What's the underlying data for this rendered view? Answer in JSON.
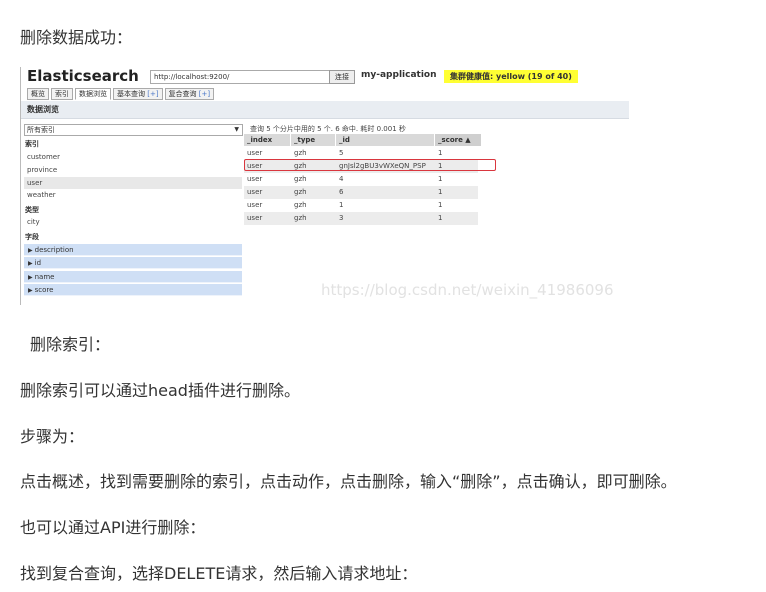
{
  "paragraphs": {
    "p1": "删除数据成功：",
    "p2": "删除索引：",
    "p3": "删除索引可以通过head插件进行删除。",
    "p4": "步骤为：",
    "p5": "点击概述，找到需要删除的索引，点击动作，点击删除，输入“删除”，点击确认，即可删除。",
    "p6": "也可以通过API进行删除：",
    "p7": "找到复合查询，选择DELETE请求，然后输入请求地址："
  },
  "screenshot": {
    "app_title": "Elasticsearch",
    "url": "http://localhost:9200/",
    "connect_label": "连接",
    "cluster_name": "my-application",
    "health_label": "集群健康值: yellow (19 of 40)",
    "health_color": "#ffff33",
    "tabs": [
      "概览",
      "索引",
      "数据浏览",
      "基本查询",
      "[+]",
      "复合查询",
      "[+]"
    ],
    "section_title": "数据浏览",
    "all_indices": "所有索引",
    "indices_label": "索引",
    "indices": [
      "customer",
      "province",
      "user",
      "weather"
    ],
    "types_label": "类型",
    "types": [
      "city"
    ],
    "fields_label": "字段",
    "fields": [
      "description",
      "id",
      "name",
      "score"
    ],
    "query_summary": "查询 5 个分片中用的 5 个. 6 命中. 耗时 0.001 秒",
    "columns": [
      "_index",
      "_type",
      "_id",
      "_score ▲"
    ],
    "rows": [
      [
        "user",
        "gzh",
        "5",
        "1"
      ],
      [
        "user",
        "gzh",
        "gnJsl2gBU3vWXeQN_PSP",
        "1"
      ],
      [
        "user",
        "gzh",
        "4",
        "1"
      ],
      [
        "user",
        "gzh",
        "6",
        "1"
      ],
      [
        "user",
        "gzh",
        "1",
        "1"
      ],
      [
        "user",
        "gzh",
        "3",
        "1"
      ]
    ],
    "highlight_color": "#d9363e",
    "watermark": "https://blog.csdn.net/weixin_41986096"
  }
}
